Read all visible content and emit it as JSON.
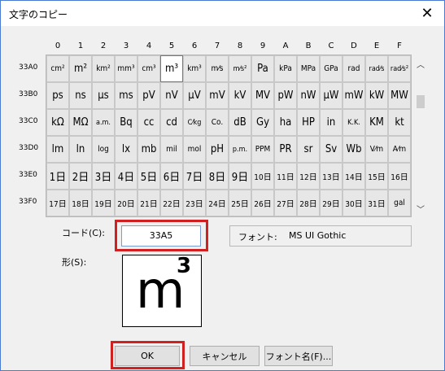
{
  "window": {
    "title": "文字のコピー"
  },
  "grid": {
    "columns": [
      "0",
      "1",
      "2",
      "3",
      "4",
      "5",
      "6",
      "7",
      "8",
      "9",
      "A",
      "B",
      "C",
      "D",
      "E",
      "F"
    ],
    "rows": [
      {
        "label": "33A0",
        "cells": [
          "cm²",
          "m²",
          "km²",
          "mm³",
          "cm³",
          "m³",
          "km³",
          "m⁄s",
          "m⁄s²",
          "Pa",
          "kPa",
          "MPa",
          "GPa",
          "rad",
          "rad⁄s",
          "rad⁄s²"
        ]
      },
      {
        "label": "33B0",
        "cells": [
          "ps",
          "ns",
          "μs",
          "ms",
          "pV",
          "nV",
          "μV",
          "mV",
          "kV",
          "MV",
          "pW",
          "nW",
          "μW",
          "mW",
          "kW",
          "MW"
        ]
      },
      {
        "label": "33C0",
        "cells": [
          "kΩ",
          "MΩ",
          "a.m.",
          "Bq",
          "cc",
          "cd",
          "C⁄kg",
          "Co.",
          "dB",
          "Gy",
          "ha",
          "HP",
          "in",
          "K.K.",
          "KM",
          "kt"
        ]
      },
      {
        "label": "33D0",
        "cells": [
          "lm",
          "ln",
          "log",
          "lx",
          "mb",
          "mil",
          "mol",
          "pH",
          "p.m.",
          "PPM",
          "PR",
          "sr",
          "Sv",
          "Wb",
          "V⁄m",
          "A⁄m"
        ]
      },
      {
        "label": "33E0",
        "cells": [
          "1日",
          "2日",
          "3日",
          "4日",
          "5日",
          "6日",
          "7日",
          "8日",
          "9日",
          "10日",
          "11日",
          "12日",
          "13日",
          "14日",
          "15日",
          "16日"
        ]
      },
      {
        "label": "33F0",
        "cells": [
          "17日",
          "18日",
          "19日",
          "20日",
          "21日",
          "22日",
          "23日",
          "24日",
          "25日",
          "26日",
          "27日",
          "28日",
          "29日",
          "30日",
          "31日",
          "gal"
        ]
      }
    ]
  },
  "code": {
    "label": "コード(C):",
    "value": "33A5"
  },
  "font": {
    "label": "フォント:",
    "value": "MS UI Gothic"
  },
  "shape": {
    "label": "形(S):",
    "main": "m",
    "sup": "3"
  },
  "buttons": {
    "ok": "OK",
    "cancel": "キャンセル",
    "font_name": "フォント名(F)..."
  },
  "colors": {
    "highlight": "#d0201f",
    "accent": "#4a7bd0"
  }
}
